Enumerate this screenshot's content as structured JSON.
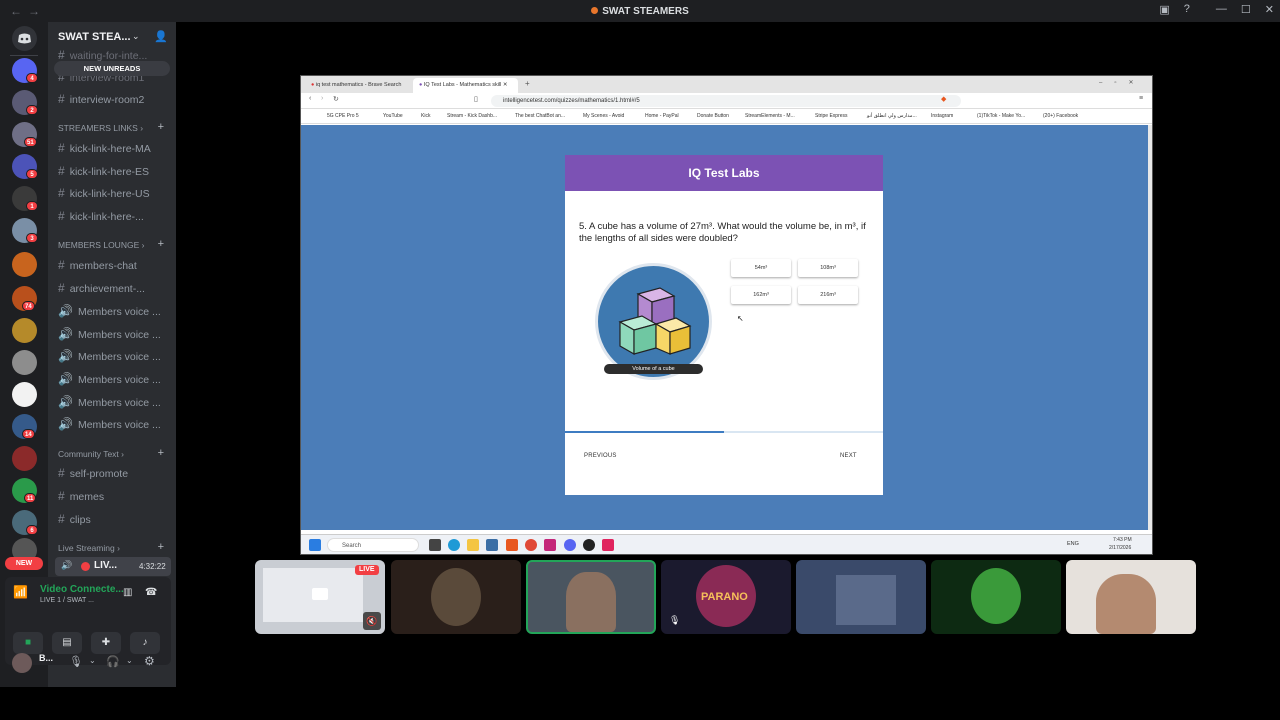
{
  "window": {
    "title": "SWAT STEAMERS",
    "back_label": "←",
    "forward_label": "→"
  },
  "titlebar_icons": [
    "inbox-icon",
    "help-icon",
    "minimize-icon",
    "maximize-icon",
    "close-icon"
  ],
  "server_rail": {
    "badges": [
      "4",
      "2",
      "51",
      "5",
      "1",
      "3",
      "74",
      "14",
      "11",
      "6"
    ],
    "new_label": "NEW"
  },
  "channels": {
    "guild_name": "SWAT STEA...",
    "new_unreads": "NEW UNREADS",
    "items": [
      {
        "type": "text",
        "label": "waiting-for-inte..."
      },
      {
        "type": "text",
        "label": "interview-room1"
      },
      {
        "type": "text",
        "label": "interview-room2"
      },
      {
        "type": "category",
        "label": "STREAMERS LINKS"
      },
      {
        "type": "text",
        "label": "kick-link-here-MA"
      },
      {
        "type": "text",
        "label": "kick-link-here-ES"
      },
      {
        "type": "text",
        "label": "kick-link-here-US"
      },
      {
        "type": "text",
        "label": "kick-link-here-..."
      },
      {
        "type": "category",
        "label": "MEMBERS LOUNGE"
      },
      {
        "type": "text",
        "label": "members-chat"
      },
      {
        "type": "text",
        "label": "archievement-..."
      },
      {
        "type": "voice",
        "label": "Members voice ..."
      },
      {
        "type": "voice",
        "label": "Members voice ..."
      },
      {
        "type": "voice",
        "label": "Members voice ..."
      },
      {
        "type": "voice",
        "label": "Members voice ..."
      },
      {
        "type": "voice",
        "label": "Members voice ..."
      },
      {
        "type": "voice",
        "label": "Members voice ..."
      },
      {
        "type": "category",
        "label": "Community Text"
      },
      {
        "type": "text",
        "label": "self-promote"
      },
      {
        "type": "text",
        "label": "memes"
      },
      {
        "type": "text",
        "label": "clips"
      },
      {
        "type": "category",
        "label": "Live Streaming"
      }
    ]
  },
  "live_channel": {
    "label": "LIV...",
    "timer": "4:32:22"
  },
  "voice_panel": {
    "status": "Video Connecte...",
    "sub": "LIVE 1 / SWAT ..."
  },
  "user": {
    "name": "B..."
  },
  "browser": {
    "tabs": [
      "iq test mathematics - Brave Search",
      "IQ Test Labs - Mathematics skill"
    ],
    "url": "intelligencetest.com/quizzes/mathematics/1.html#/5",
    "bookmarks": [
      "5G CPE Pro 5",
      "YouTube",
      "Kick",
      "Stream - Kick Dashb...",
      "The best ChatBot an...",
      "My Scenes - Avoid",
      "Home - PayPal",
      "Donate Button",
      "StreamElements - M...",
      "Stripe Express",
      "مدارس ولي انطلق أنو...",
      "Instagram",
      "(1)TikTok - Make Yo...",
      "(20+) Facebook"
    ]
  },
  "quiz": {
    "site_title": "IQ Test Labs",
    "question": "5. A cube has a volume of 27m³. What would the volume be, in m³, if the lengths of all sides were doubled?",
    "answers": [
      "54m³",
      "108m³",
      "162m³",
      "216m³"
    ],
    "image_caption": "Volume of a cube",
    "progress": 0.5,
    "prev_label": "PREVIOUS",
    "next_label": "NEXT"
  },
  "taskbar": {
    "search_placeholder": "Search",
    "lang": "ENG",
    "time": "7:43 PM",
    "date": "2/17/2026"
  },
  "stream_tiles": {
    "live_badge": "LIVE",
    "overlay_text": "PARANO"
  }
}
